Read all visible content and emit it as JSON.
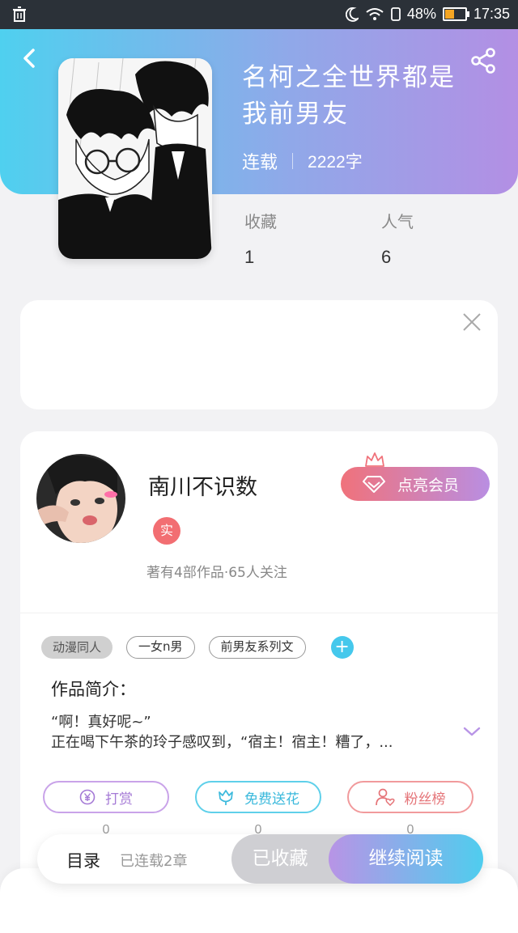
{
  "status_bar": {
    "battery": "48%",
    "time": "17:35",
    "battery_level": 0.48
  },
  "book": {
    "title_line1": "名柯之全世界都是",
    "title_line2": "我前男友",
    "status": "连载",
    "word_count": "2222字",
    "favorites_label": "收藏",
    "favorites_value": "1",
    "popularity_label": "人气",
    "popularity_value": "6"
  },
  "author": {
    "name": "南川不识数",
    "badge": "实",
    "stats": "著有4部作品·65人关注",
    "vip_button": "点亮会员"
  },
  "tags": [
    "动漫同人",
    "一女n男",
    "前男友系列文"
  ],
  "intro": {
    "label": "作品简介：",
    "line1": "“啊！真好呢~”",
    "line2": "正在喝下午茶的玲子感叹到，“宿主！宿主！糟了，..."
  },
  "actions": {
    "tip": {
      "label": "打赏",
      "count": "0"
    },
    "flower": {
      "label": "免费送花",
      "count": "0"
    },
    "fans": {
      "label": "粉丝榜",
      "count": "0"
    }
  },
  "bottom_bar": {
    "toc": "目录",
    "chapters": "已连载2章",
    "collected": "已收藏",
    "continue": "继续阅读"
  },
  "colors": {
    "header_gradient_start": "#4fd0ef",
    "header_gradient_end": "#b38fe4",
    "accent_pink": "#f26e72",
    "accent_blue": "#45c8ec"
  }
}
